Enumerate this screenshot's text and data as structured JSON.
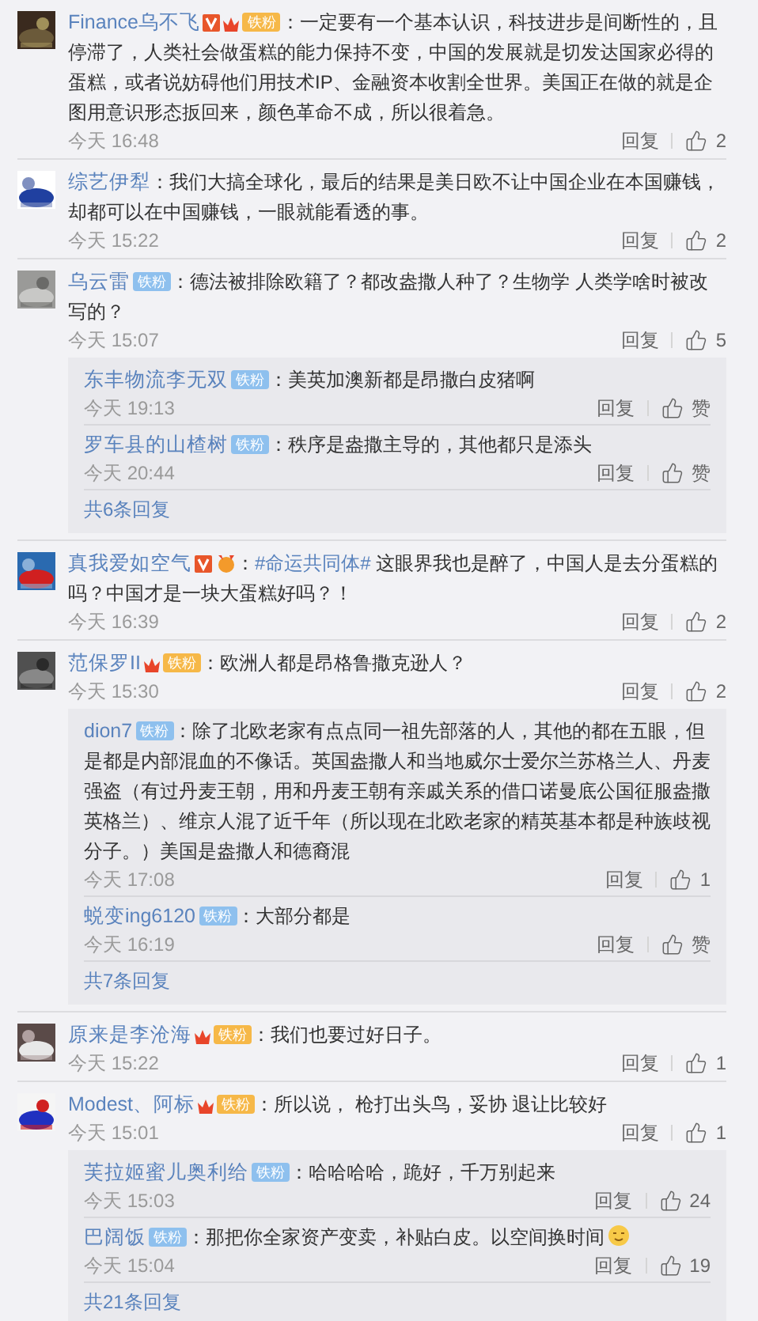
{
  "comments": [
    {
      "user": "Finance乌不飞",
      "badges": [
        {
          "kind": "verified"
        },
        {
          "kind": "crown",
          "label": "铁粉"
        }
      ],
      "text": "：一定要有一个基本认识，科技进步是间断性的，且停滞了，人类社会做蛋糕的能力保持不变，中国的发展就是切发达国家必得的蛋糕，或者说妨碍他们用技术IP、金融资本收割全世界。美国正在做的就是企图用意识形态扳回来，颜色革命不成，所以很着急。",
      "time": "今天 16:48",
      "reply_label": "回复",
      "likes": "2"
    },
    {
      "user": "综艺伊犁",
      "text": "：我们大搞全球化，最后的结果是美日欧不让中国企业在本国赚钱，却都可以在中国赚钱，一眼就能看透的事。",
      "time": "今天 15:22",
      "reply_label": "回复",
      "likes": "2"
    },
    {
      "user": "乌云雷",
      "badges": [
        {
          "kind": "fan",
          "label": "铁粉"
        }
      ],
      "text": "：德法被排除欧籍了？都改盎撒人种了？生物学 人类学啥时被改写的？",
      "time": "今天 15:07",
      "reply_label": "回复",
      "likes": "5",
      "replies": [
        {
          "user": "东丰物流李无双",
          "badges": [
            {
              "kind": "fan",
              "label": "铁粉"
            }
          ],
          "text": "：美英加澳新都是昂撒白皮猪啊",
          "time": "今天 19:13",
          "reply_label": "回复",
          "likes": "赞"
        },
        {
          "user": "罗车县的山楂树",
          "badges": [
            {
              "kind": "fan",
              "label": "铁粉"
            }
          ],
          "text": "：秩序是盎撒主导的，其他都只是添头",
          "time": "今天 20:44",
          "reply_label": "回复",
          "likes": "赞"
        }
      ],
      "more_label": "共6条回复"
    },
    {
      "user": "真我爱如空气",
      "badges": [
        {
          "kind": "verified"
        },
        {
          "kind": "medal"
        }
      ],
      "text": "：",
      "hashtag": "#命运共同体#",
      "text_after": " 这眼界我也是醉了，中国人是去分蛋糕的吗？中国才是一块大蛋糕好吗？！",
      "time": "今天 16:39",
      "reply_label": "回复",
      "likes": "2"
    },
    {
      "user": "范保罗II",
      "badges": [
        {
          "kind": "crown",
          "label": "铁粉"
        }
      ],
      "text": "：欧洲人都是昂格鲁撒克逊人？",
      "time": "今天 15:30",
      "reply_label": "回复",
      "likes": "2",
      "replies": [
        {
          "user": "dion7",
          "badges": [
            {
              "kind": "fan",
              "label": "铁粉"
            }
          ],
          "text": "：除了北欧老家有点点同一祖先部落的人，其他的都在五眼，但是都是内部混血的不像话。英国盎撒人和当地威尔士爱尔兰苏格兰人、丹麦强盗（有过丹麦王朝，用和丹麦王朝有亲戚关系的借口诺曼底公国征服盎撒英格兰）、维京人混了近千年（所以现在北欧老家的精英基本都是种族歧视分子。）美国是盎撒人和德裔混",
          "time": "今天 17:08",
          "reply_label": "回复",
          "likes": "1"
        },
        {
          "user": "蜕变ing6120",
          "badges": [
            {
              "kind": "fan",
              "label": "铁粉"
            }
          ],
          "text": "：大部分都是",
          "time": "今天 16:19",
          "reply_label": "回复",
          "likes": "赞"
        }
      ],
      "more_label": "共7条回复"
    },
    {
      "user": "原来是李沧海",
      "badges": [
        {
          "kind": "crown",
          "label": "铁粉"
        }
      ],
      "text": "：我们也要过好日子。",
      "time": "今天 15:22",
      "reply_label": "回复",
      "likes": "1"
    },
    {
      "user": "Modest、阿标",
      "badges": [
        {
          "kind": "crown",
          "label": "铁粉"
        }
      ],
      "text": "：所以说， 枪打出头鸟，妥协 退让比较好",
      "time": "今天 15:01",
      "reply_label": "回复",
      "likes": "1",
      "replies": [
        {
          "user": "芙拉姬蜜儿奥利给",
          "badges": [
            {
              "kind": "fan",
              "label": "铁粉"
            }
          ],
          "text": "：哈哈哈哈，跪好，千万别起来",
          "time": "今天 15:03",
          "reply_label": "回复",
          "likes": "24"
        },
        {
          "user": "巴阔饭",
          "badges": [
            {
              "kind": "fan",
              "label": "铁粉"
            }
          ],
          "text": "：那把你全家资产变卖，补贴白皮。以空间换时间",
          "emoji": true,
          "time": "今天 15:04",
          "reply_label": "回复",
          "likes": "19"
        }
      ],
      "more_label": "共21条回复"
    }
  ]
}
